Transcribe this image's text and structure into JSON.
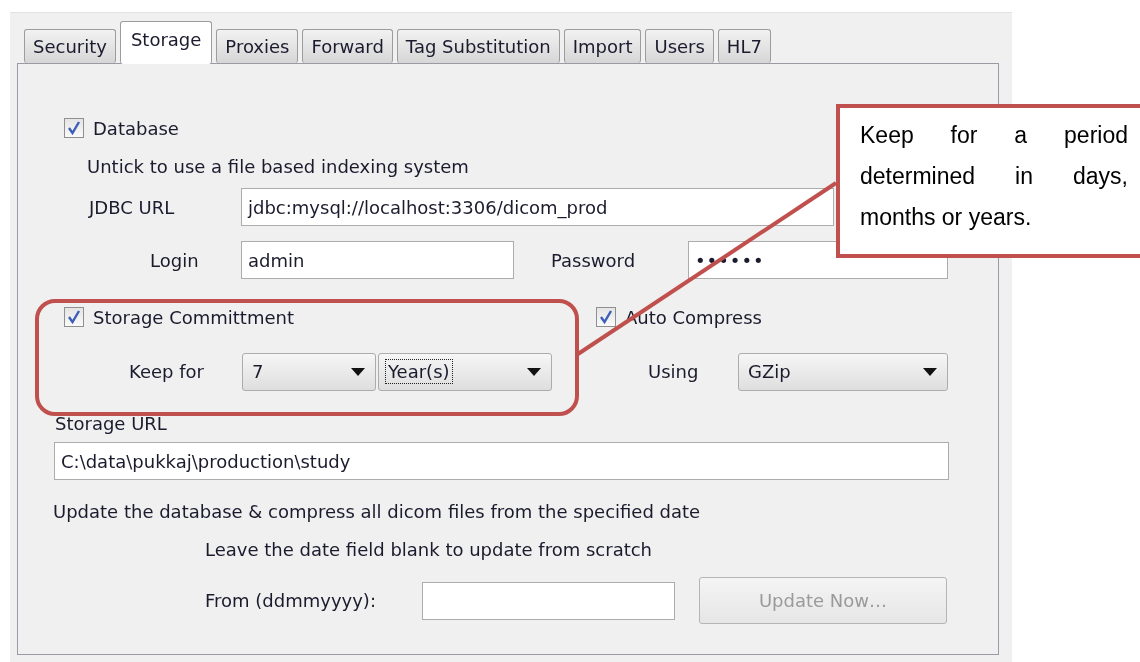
{
  "tabs": [
    {
      "label": "Security",
      "selected": false
    },
    {
      "label": "Storage",
      "selected": true
    },
    {
      "label": "Proxies",
      "selected": false
    },
    {
      "label": "Forward",
      "selected": false
    },
    {
      "label": "Tag Substitution",
      "selected": false
    },
    {
      "label": "Import",
      "selected": false
    },
    {
      "label": "Users",
      "selected": false
    },
    {
      "label": "HL7",
      "selected": false
    }
  ],
  "database": {
    "label": "Database",
    "checked": true,
    "hint": "Untick to use a file based indexing system"
  },
  "jdbc_url": {
    "label": "JDBC URL",
    "value": "jdbc:mysql://localhost:3306/dicom_prod"
  },
  "login": {
    "label": "Login",
    "value": "admin"
  },
  "password": {
    "label": "Password",
    "value": "••••••"
  },
  "storage_commitment": {
    "label": "Storage Committment",
    "checked": true,
    "keep_for_label": "Keep for",
    "amount": "7",
    "unit": {
      "value": "Year(s)",
      "focused": true
    }
  },
  "auto_compress": {
    "label": "Auto Compress",
    "checked": true,
    "using_label": "Using",
    "method": "GZip"
  },
  "storage_url": {
    "label": "Storage URL",
    "value": "C:\\data\\pukkaj\\production\\study"
  },
  "update": {
    "description": "Update the database & compress all dicom files from the specified date",
    "hint": "Leave the date field blank to update from scratch",
    "from_label": "From (ddmmyyyy):",
    "button": {
      "label": "Update Now…",
      "disabled": true
    }
  },
  "callout": {
    "text": "Keep for a period determined in days, months or years."
  }
}
